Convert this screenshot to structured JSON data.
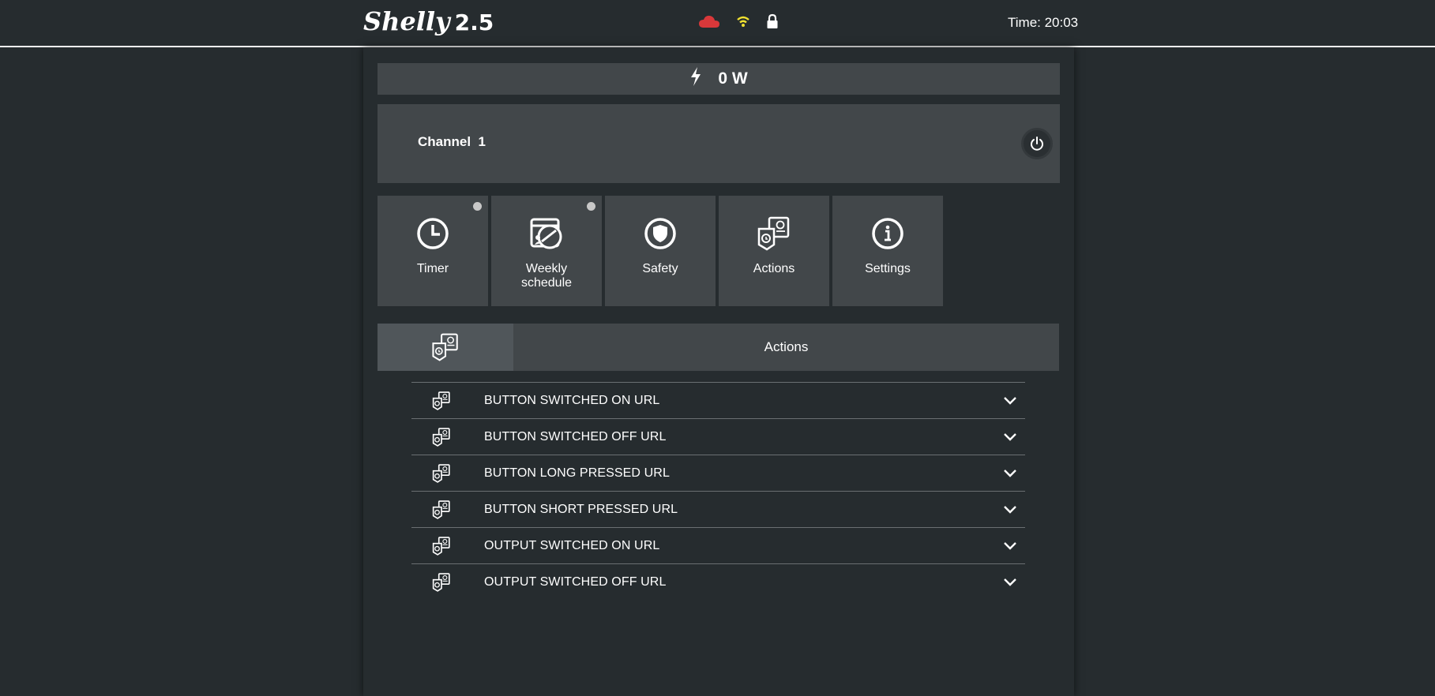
{
  "header": {
    "brand": "Shelly",
    "model": "2.5",
    "time_text": "Time: 20:03",
    "status_icons": [
      "cloud-icon",
      "wifi-icon",
      "lock-icon"
    ],
    "colors": {
      "cloud": "#d9383a",
      "wifi": "#f0e130",
      "lock": "#ffffff"
    }
  },
  "power": {
    "value": "0 W"
  },
  "channel": {
    "name": "Channel  1"
  },
  "tiles": [
    {
      "label": "Timer",
      "icon": "clock-icon",
      "dot": true
    },
    {
      "label": "Weekly schedule",
      "icon": "schedule-icon",
      "dot": true
    },
    {
      "label": "Safety",
      "icon": "shield-icon",
      "dot": false
    },
    {
      "label": "Actions",
      "icon": "actions-icon",
      "dot": false
    },
    {
      "label": "Settings",
      "icon": "info-icon",
      "dot": false
    }
  ],
  "section": {
    "title": "Actions",
    "icon": "actions-icon"
  },
  "actions": [
    {
      "label": "BUTTON SWITCHED ON URL"
    },
    {
      "label": "BUTTON SWITCHED OFF URL"
    },
    {
      "label": "BUTTON LONG PRESSED URL"
    },
    {
      "label": "BUTTON SHORT PRESSED URL"
    },
    {
      "label": "OUTPUT SWITCHED ON URL"
    },
    {
      "label": "OUTPUT SWITCHED OFF URL"
    }
  ]
}
